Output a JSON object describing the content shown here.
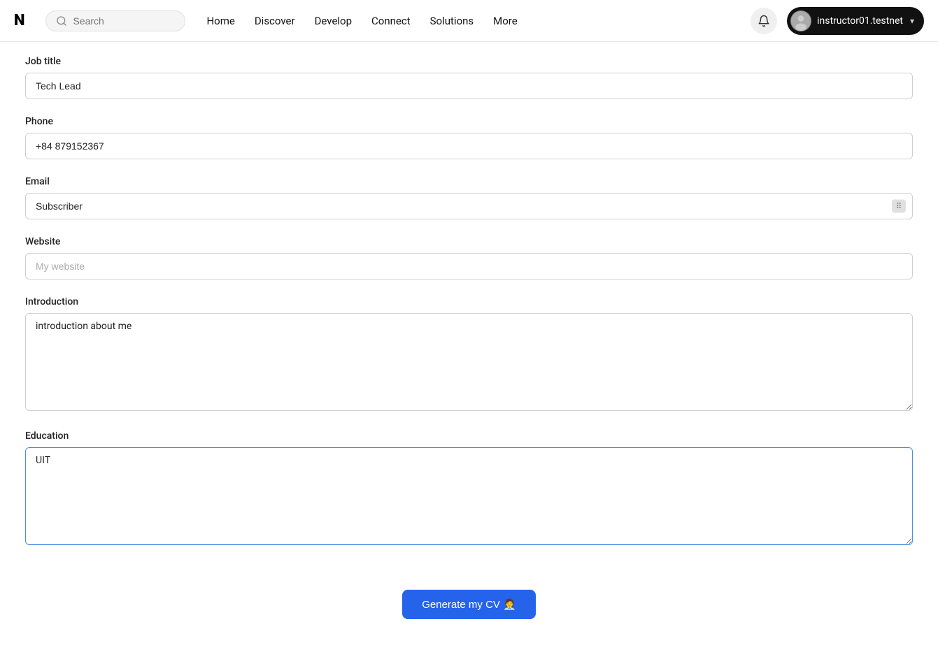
{
  "navbar": {
    "logo": "N",
    "search_placeholder": "Search",
    "nav_items": [
      {
        "label": "Home",
        "id": "home"
      },
      {
        "label": "Discover",
        "id": "discover"
      },
      {
        "label": "Develop",
        "id": "develop"
      },
      {
        "label": "Connect",
        "id": "connect"
      },
      {
        "label": "Solutions",
        "id": "solutions"
      },
      {
        "label": "More",
        "id": "more"
      }
    ],
    "user": {
      "username": "instructor01.testnet",
      "chevron": "▾"
    },
    "notification_icon": "🔔"
  },
  "form": {
    "job_title": {
      "label": "Job title",
      "value": "Tech Lead",
      "placeholder": ""
    },
    "phone": {
      "label": "Phone",
      "value": "+84 879152367",
      "placeholder": ""
    },
    "email": {
      "label": "Email",
      "value": "Subscriber",
      "placeholder": ""
    },
    "website": {
      "label": "Website",
      "value": "",
      "placeholder": "My website"
    },
    "introduction": {
      "label": "Introduction",
      "value": "introduction about me",
      "placeholder": ""
    },
    "education": {
      "label": "Education",
      "value": "UIT",
      "placeholder": ""
    },
    "generate_btn_label": "Generate my CV 🧑‍💼"
  }
}
